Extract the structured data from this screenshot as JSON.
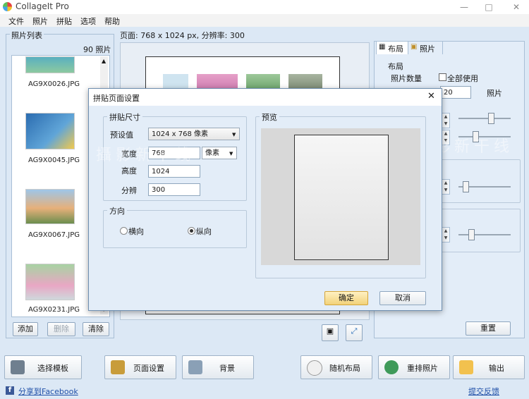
{
  "app": {
    "title": "CollageIt Pro"
  },
  "menu": [
    "文件",
    "照片",
    "拼贴",
    "选项",
    "帮助"
  ],
  "photo_list": {
    "title": "照片列表",
    "count": "90 照片",
    "items": [
      "AG9X0026.JPG",
      "AG9X0045.JPG",
      "AG9X0067.JPG",
      "AG9X0231.JPG"
    ],
    "add_label": "添加",
    "delete_label": "删除",
    "clear_label": "清除"
  },
  "page_info": "页面: 768 x 1024 px, 分辨率: 300",
  "right_panel": {
    "tab_layout": "布局",
    "tab_photo": "照片",
    "layout_group": "布局",
    "photo_count_label": "照片数量",
    "use_all_label": "全部使用",
    "photo_count_value": "20",
    "photo_unit": "照片",
    "reset_label": "重置"
  },
  "dialog": {
    "title": "拼贴页面设置",
    "size_group": "拼贴尺寸",
    "preset_label": "预设值",
    "preset_value": "1024 x 768 像素",
    "width_label": "宽度",
    "width_value": "768",
    "unit_value": "像素",
    "height_label": "高度",
    "height_value": "1024",
    "resolution_label": "分辨",
    "resolution_value": "300",
    "orientation_group": "方向",
    "landscape_label": "横向",
    "portrait_label": "纵向",
    "preview_group": "预览",
    "ok_label": "确定",
    "cancel_label": "取消"
  },
  "bottom": {
    "choose_template": "选择模板",
    "page_setup": "页面设置",
    "background": "背景",
    "random_layout": "随机布局",
    "shuffle_photos": "重排照片",
    "output": "输出",
    "share_facebook": "分享到Facebook",
    "feedback": "提交反馈"
  },
  "watermark": "攝影新干线",
  "colors": {
    "accent": "#1f4fa8",
    "ok_button": "#f7dc8c",
    "window_bg": "#dce8f5"
  }
}
